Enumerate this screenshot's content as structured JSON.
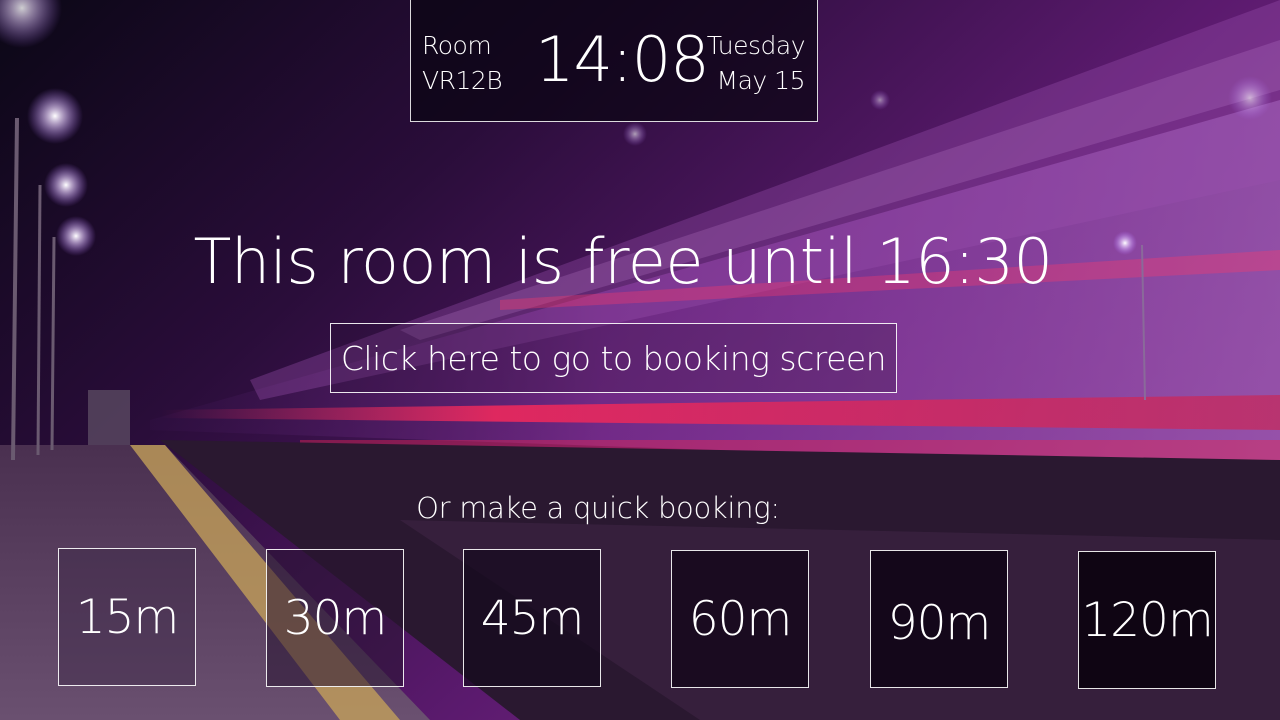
{
  "header": {
    "room_label": "Room",
    "room_name": "VR12B",
    "time": "14:08",
    "weekday": "Tuesday",
    "date": "May 15"
  },
  "status": {
    "message": "This room is free until 16:30"
  },
  "booking": {
    "button_label": "Click here to go to booking screen"
  },
  "quick_booking": {
    "label": "Or make a quick booking:",
    "options": [
      "15m",
      "30m",
      "45m",
      "60m",
      "90m",
      "120m"
    ]
  },
  "background": {
    "description_icon": "night-train-station-background",
    "accent": "#7a1fa0"
  }
}
